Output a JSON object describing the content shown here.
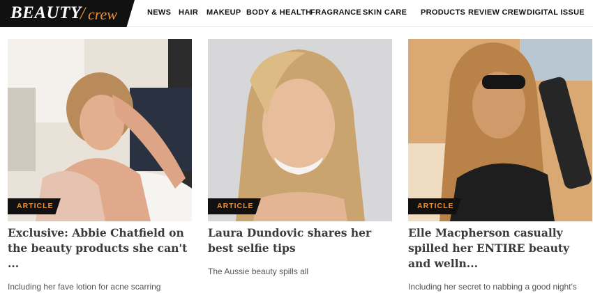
{
  "brand": {
    "name": "BEAUTY",
    "separator": "/",
    "sub": "crew"
  },
  "nav": [
    "NEWS",
    "HAIR",
    "MAKEUP",
    "BODY & HEALTH",
    "FRAGRANCE",
    "SKIN CARE",
    "PRODUCTS",
    "REVIEW CREW",
    "DIGITAL ISSUE"
  ],
  "cards": [
    {
      "badge": "ARTICLE",
      "title": "Exclusive: Abbie Chatfield on the beauty products she can't ...",
      "subtitle": "Including her fave lotion for acne scarring"
    },
    {
      "badge": "ARTICLE",
      "title": "Laura Dundovic shares her best selfie tips",
      "subtitle": "The Aussie beauty spills all"
    },
    {
      "badge": "ARTICLE",
      "title": "Elle Macpherson casually spilled her ENTIRE beauty and welln...",
      "subtitle": "Including her secret to nabbing a good night's sleep"
    }
  ],
  "colors": {
    "accent": "#e8913a",
    "dark": "#111111"
  }
}
